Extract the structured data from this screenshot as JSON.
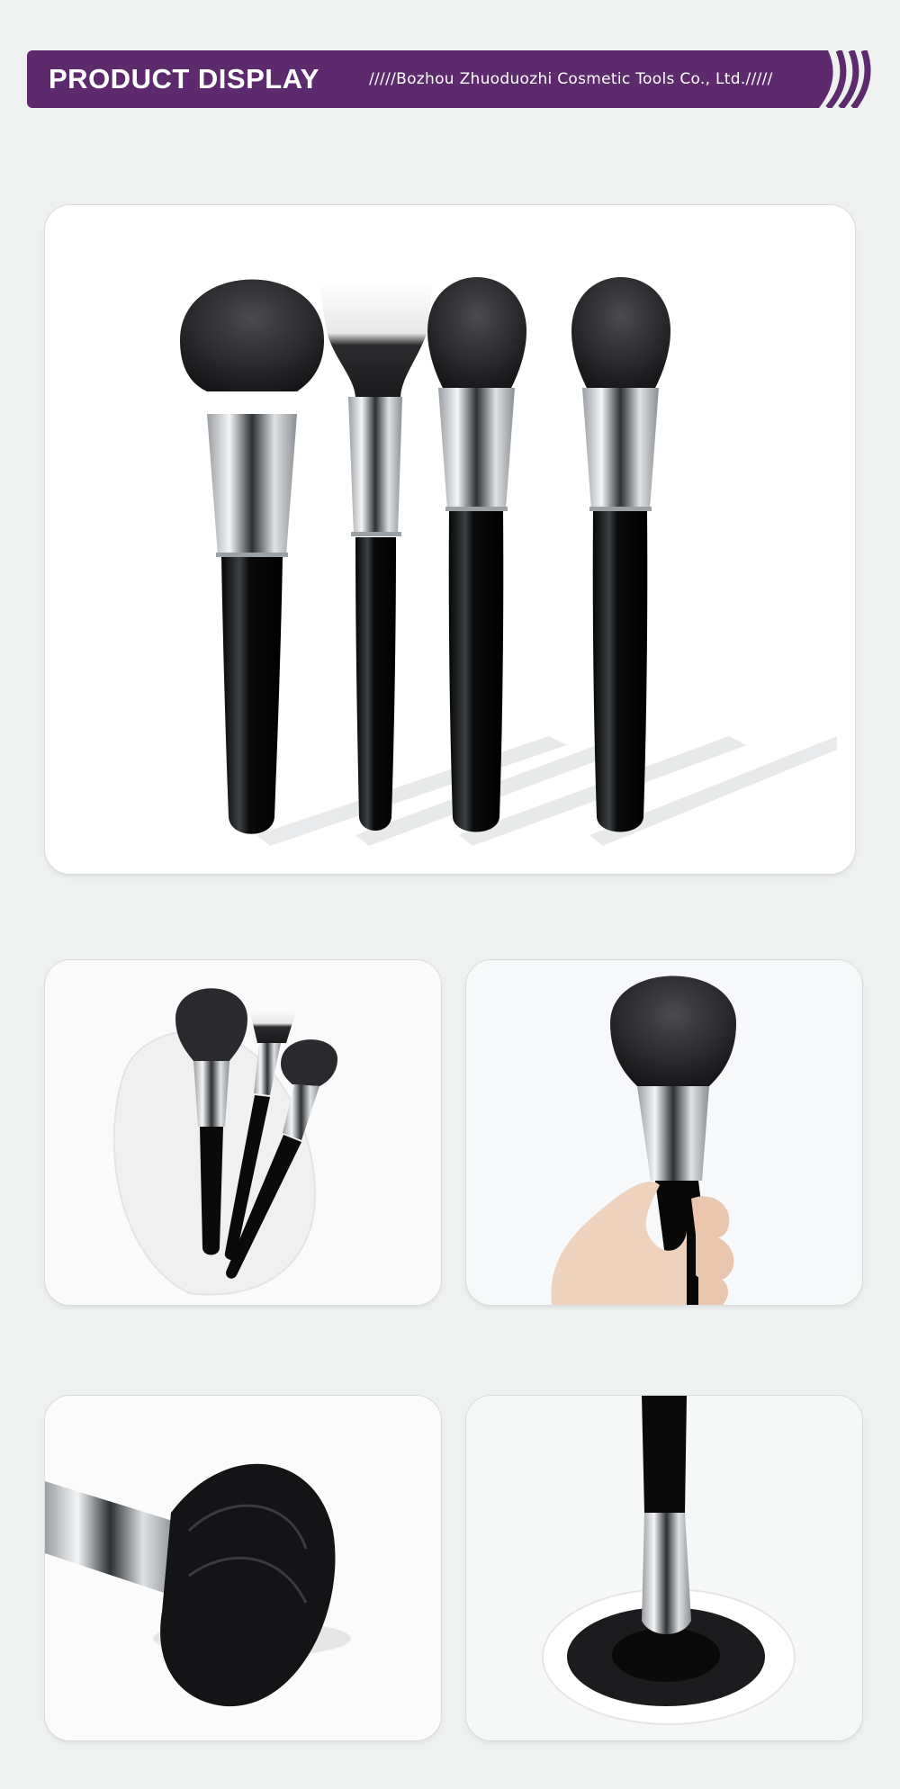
{
  "banner": {
    "title": "PRODUCT DISPLAY",
    "company": "/////Bozhou Zhuoduozhi Cosmetic Tools Co., Ltd./////",
    "background_color": "#5e2a6e",
    "text_color": "#ffffff"
  },
  "photos": [
    {
      "subject": "four-brushes-lineup"
    },
    {
      "subject": "three-brushes-on-cream"
    },
    {
      "subject": "brush-held-in-hand"
    },
    {
      "subject": "brush-head-closeup"
    },
    {
      "subject": "brush-top-down-splayed"
    }
  ]
}
